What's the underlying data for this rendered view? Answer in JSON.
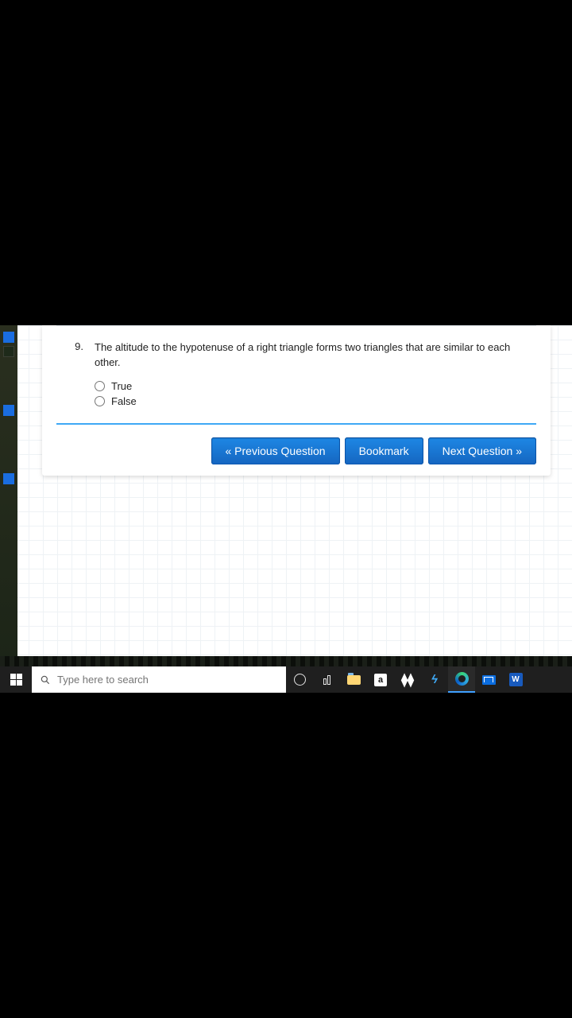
{
  "question": {
    "number": "9.",
    "text": "The altitude to the hypotenuse of a right triangle forms two triangles that are similar to each other.",
    "options": [
      "True",
      "False"
    ]
  },
  "nav": {
    "prev": "« Previous Question",
    "bookmark": "Bookmark",
    "next": "Next Question »"
  },
  "taskbar": {
    "search_placeholder": "Type here to search",
    "amazon_letter": "a",
    "word_letter": "W"
  }
}
